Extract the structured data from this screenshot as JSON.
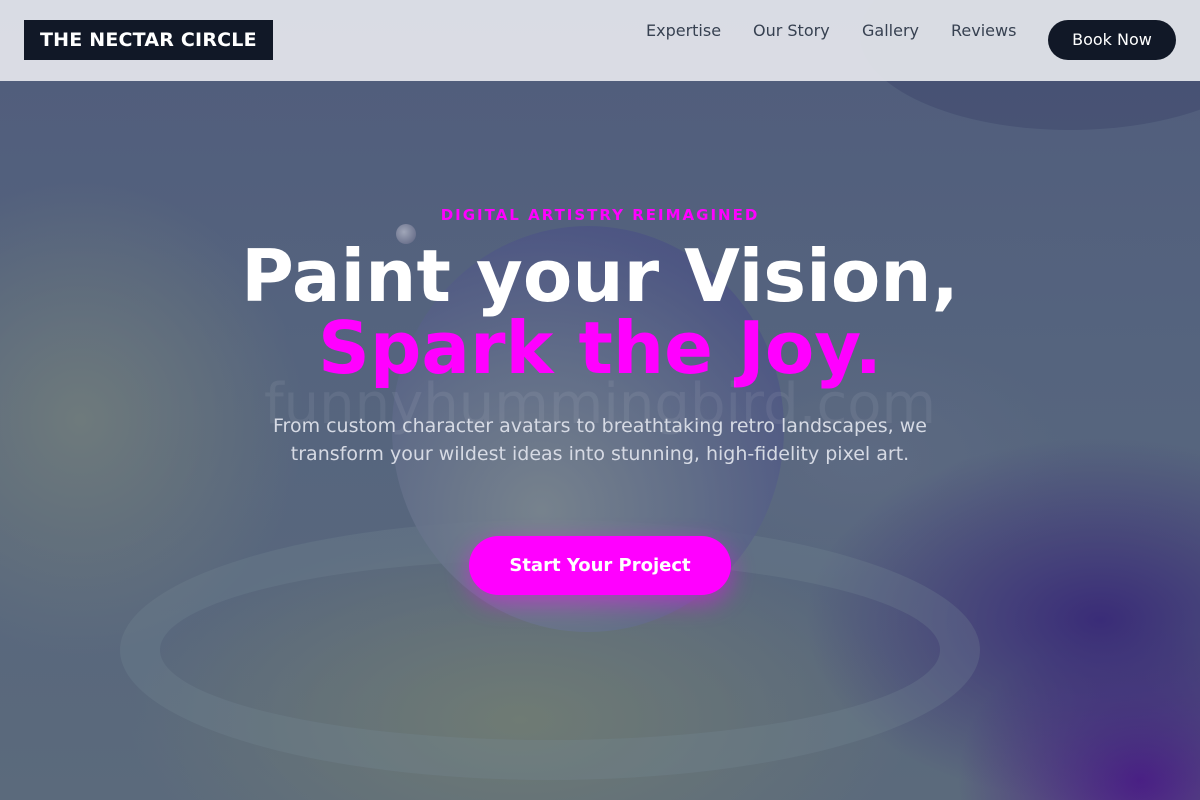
{
  "brand": {
    "name": "THE NECTAR CIRCLE"
  },
  "nav": {
    "links": [
      "Expertise",
      "Our Story",
      "Gallery",
      "Reviews"
    ],
    "cta": "Book Now"
  },
  "hero": {
    "eyebrow": "DIGITAL ARTISTRY REIMAGINED",
    "headline_line1": "Paint your Vision,",
    "headline_line2": "Spark the Joy.",
    "watermark": "funnyhummingbird.com",
    "subtext": "From custom character avatars to breathtaking retro landscapes, we transform your wildest ideas into stunning, high-fidelity pixel art.",
    "cta": "Start Your Project"
  },
  "colors": {
    "accent": "#ff00ff",
    "dark": "#111827",
    "navbar_bg": "#e4e6ec"
  }
}
